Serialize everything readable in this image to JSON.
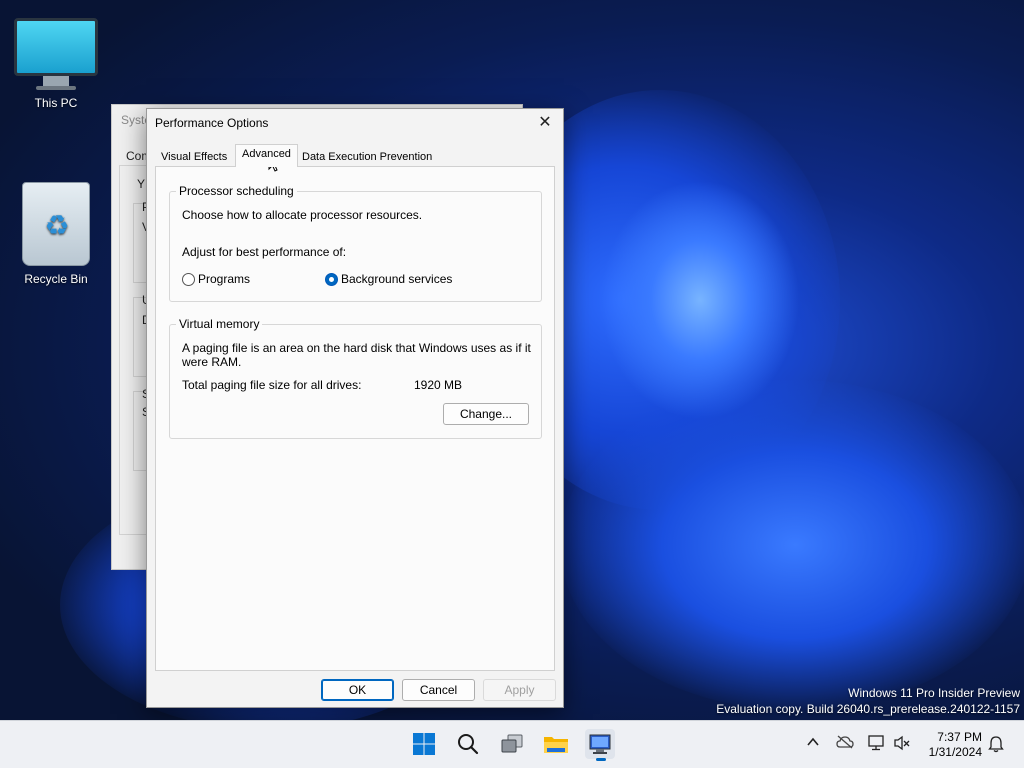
{
  "desktop": {
    "icons": [
      {
        "label": "This PC",
        "icon": "monitor-icon"
      },
      {
        "label": "Recycle Bin",
        "icon": "recycle-bin-icon"
      }
    ]
  },
  "background_window": {
    "title_fragment": "Syste",
    "tab_fragment": "Com",
    "text_fragments": [
      "Y",
      "P",
      "V",
      "U",
      "D",
      "S",
      "S"
    ]
  },
  "dialog": {
    "title": "Performance Options",
    "close_icon": "close-icon",
    "tabs": [
      {
        "label": "Visual Effects",
        "active": false
      },
      {
        "label": "Advanced",
        "active": true
      },
      {
        "label": "Data Execution Prevention",
        "active": false
      }
    ],
    "processor_scheduling": {
      "group_label": "Processor scheduling",
      "description": "Choose how to allocate processor resources.",
      "adjust_label": "Adjust for best performance of:",
      "options": [
        {
          "label": "Programs",
          "selected": false
        },
        {
          "label": "Background services",
          "selected": true
        }
      ]
    },
    "virtual_memory": {
      "group_label": "Virtual memory",
      "description_line1": "A paging file is an area on the hard disk that Windows uses as if it",
      "description_line2": "were RAM.",
      "total_label": "Total paging file size for all drives:",
      "total_value": "1920 MB",
      "change_button": "Change..."
    },
    "buttons": {
      "ok": "OK",
      "cancel": "Cancel",
      "apply": "Apply"
    }
  },
  "watermark": {
    "line1": "Windows 11 Pro Insider Preview",
    "line2": "Evaluation copy. Build 26040.rs_prerelease.240122-1157"
  },
  "taskbar": {
    "apps": [
      "start-icon",
      "search-icon",
      "task-view-icon",
      "file-explorer-icon",
      "system-properties-icon"
    ],
    "tray_icons": [
      "chevron-up-icon",
      "onedrive-icon",
      "network-icon",
      "volume-muted-icon"
    ],
    "time": "7:37 PM",
    "date": "1/31/2024",
    "notification_icon": "bell-icon"
  },
  "colors": {
    "accent": "#0067c0",
    "wallpaper_dark": "#0a1c52",
    "wallpaper_bright": "#2e6cff"
  }
}
